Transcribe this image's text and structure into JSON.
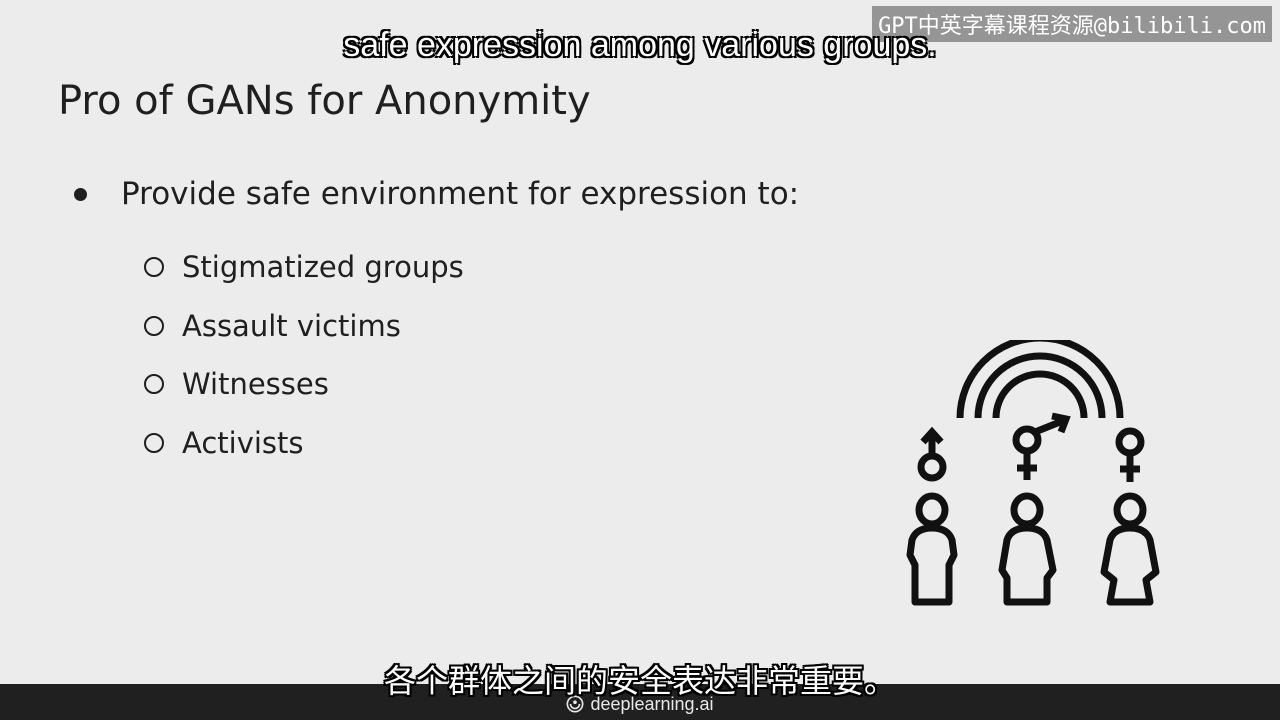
{
  "overlay": {
    "watermark": "GPT中英字幕课程资源@bilibili.com",
    "subtitle_en": "safe expression among various groups.",
    "subtitle_zh": "各个群体之间的安全表达非常重要。"
  },
  "slide": {
    "title": "Pro of GANs for Anonymity",
    "main_bullet": "Provide safe environment for expression to:",
    "sub_bullets": [
      "Stigmatized groups",
      "Assault victims",
      "Witnesses",
      "Activists"
    ]
  },
  "illustration": {
    "icons": [
      "rainbow-icon",
      "male-symbol-icon",
      "transgender-symbol-icon",
      "female-symbol-icon",
      "person-icon"
    ]
  },
  "footer": {
    "brand": "deeplearning.ai"
  }
}
